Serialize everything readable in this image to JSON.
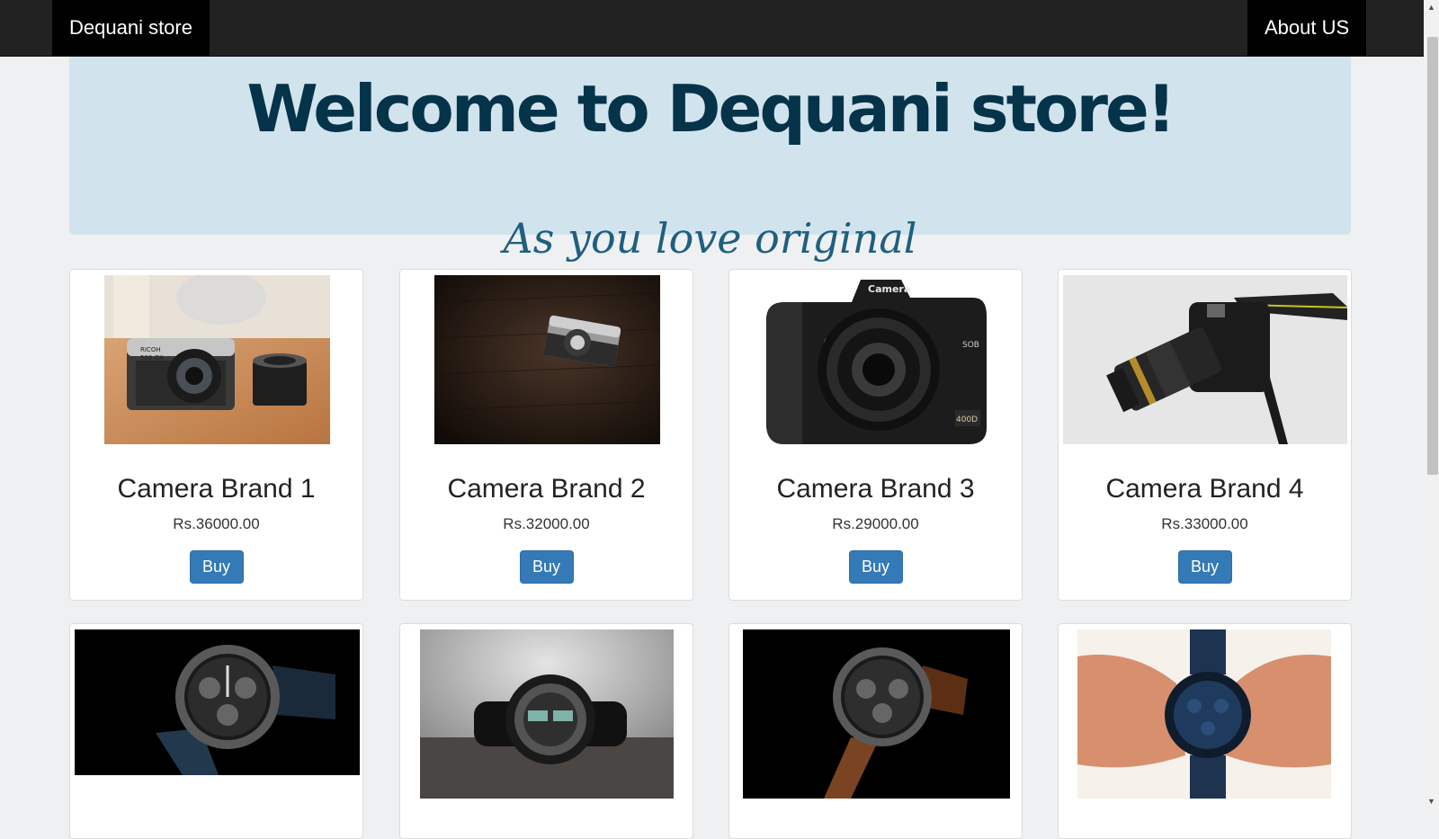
{
  "navbar": {
    "brand": "Dequani store",
    "about": "About US"
  },
  "jumbotron": {
    "title": "Welcome to Dequani store!",
    "subtitle": "As you love original"
  },
  "products": [
    {
      "name": "Camera Brand 1",
      "price": "Rs.36000.00",
      "buy": "Buy",
      "image": "retro-camera-and-lens-photo"
    },
    {
      "name": "Camera Brand 2",
      "price": "Rs.32000.00",
      "buy": "Buy",
      "image": "camera-on-dark-wood-photo"
    },
    {
      "name": "Camera Brand 3",
      "price": "Rs.29000.00",
      "buy": "Buy",
      "image": "black-dslr-camera-photo"
    },
    {
      "name": "Camera Brand 4",
      "price": "Rs.33000.00",
      "buy": "Buy",
      "image": "dslr-with-strap-photo"
    },
    {
      "image": "watch-blue-strap-photo"
    },
    {
      "image": "sport-watch-on-sand-photo"
    },
    {
      "image": "watch-brown-strap-photo"
    },
    {
      "image": "watch-in-hands-photo"
    }
  ],
  "camera_text": {
    "brand_cap": "Camera",
    "ricoh": "RICOH",
    "model": "500 GX",
    "sob": "SOB",
    "badge": "400D"
  },
  "colors": {
    "navbar": "#222222",
    "jumbotron": "#d1e4ee",
    "title": "#053349",
    "subtitle": "#1f5f80",
    "button": "#337ab7"
  }
}
